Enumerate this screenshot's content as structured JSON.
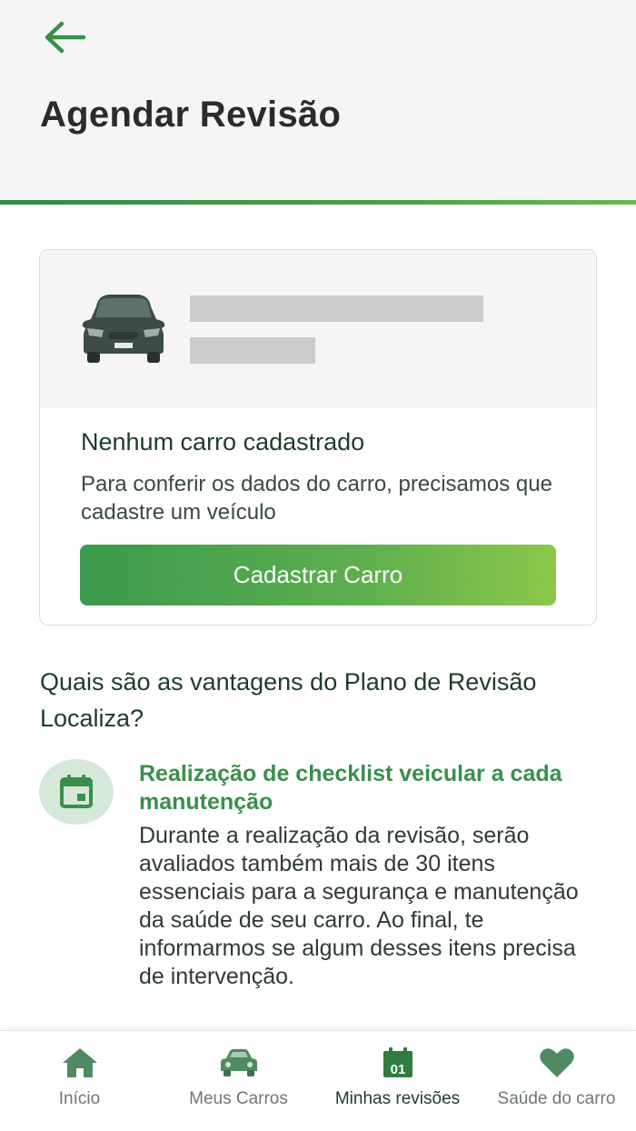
{
  "header": {
    "title": "Agendar Revisão",
    "back_icon": "arrow-left-icon"
  },
  "colors": {
    "accent": "#3a8f4a",
    "button_gradient_start": "#3b9a4c",
    "button_gradient_end": "#8cc84a",
    "header_bg": "#f5f5f5",
    "placeholder": "#cbcdcc"
  },
  "car_card": {
    "illustration": "car-front-icon",
    "title": "Nenhum carro cadastrado",
    "description": "Para conferir os dados do carro, precisamos que cadastre um veículo",
    "button_label": "Cadastrar Carro"
  },
  "advantages": {
    "title": "Quais são as vantagens do Plano de Revisão Localiza?",
    "items": [
      {
        "icon": "calendar-icon",
        "title": "Realização de checklist veicular a cada manutenção",
        "text": "Durante a realização da revisão, serão avaliados também mais de 30 itens essenciais para a segurança e manutenção da saúde de seu carro. Ao final, te informarmos se algum desses itens precisa de intervenção."
      }
    ]
  },
  "bottom_nav": {
    "items": [
      {
        "label": "Início",
        "icon": "home-icon",
        "active": false
      },
      {
        "label": "Meus Carros",
        "icon": "car-icon",
        "active": false
      },
      {
        "label": "Minhas revisões",
        "icon": "calendar-icon",
        "icon_text": "01",
        "active": true
      },
      {
        "label": "Saúde do carro",
        "icon": "heart-icon",
        "active": false
      }
    ]
  }
}
